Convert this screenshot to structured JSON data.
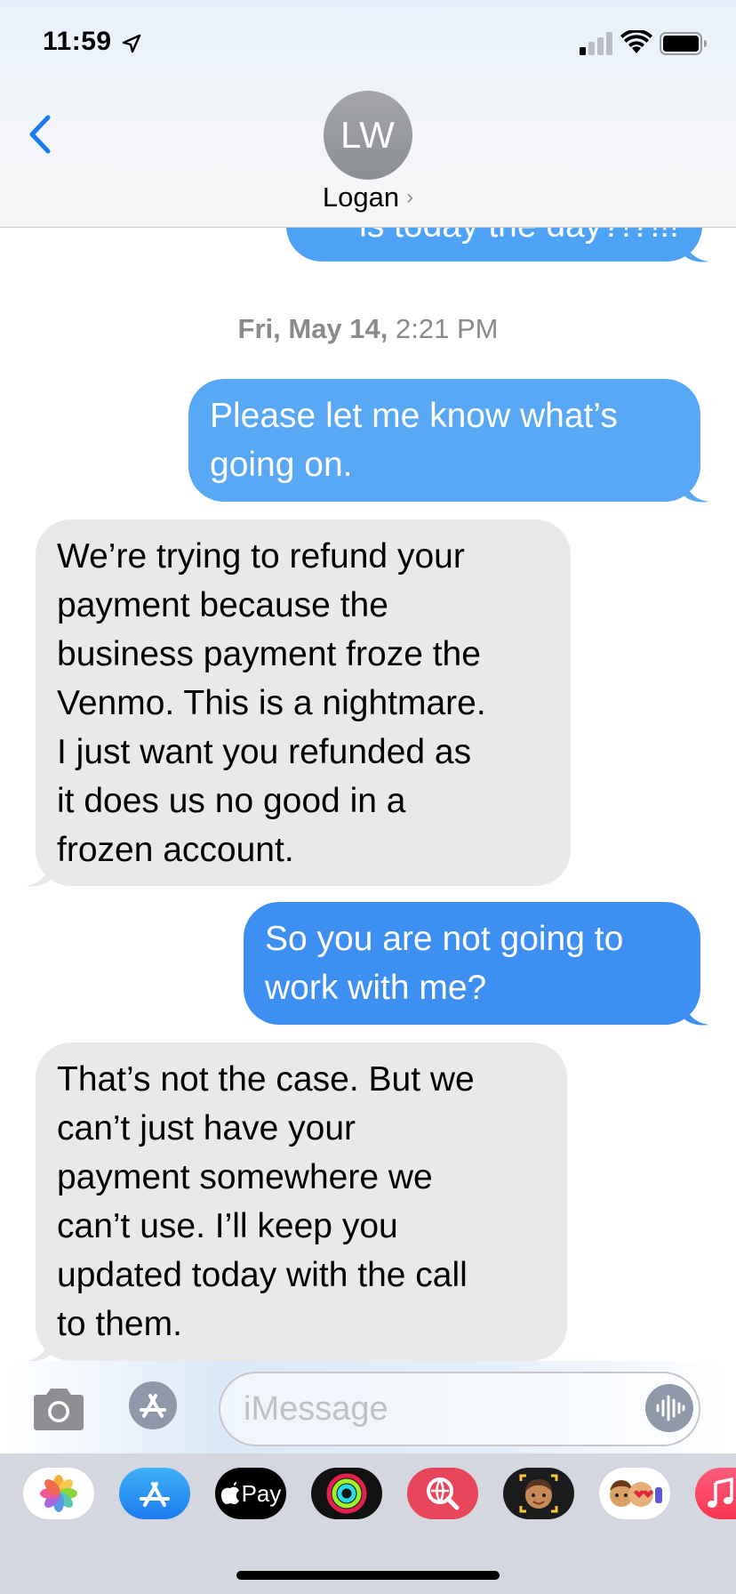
{
  "status_bar": {
    "time": "11:59"
  },
  "header": {
    "avatar_initials": "LW",
    "contact_name": "Logan",
    "chevron": "›"
  },
  "messages": {
    "partial_top": "is today the day?!?!!!",
    "timestamp_date": "Fri, May 14,",
    "timestamp_time": "2:21 PM",
    "items": [
      {
        "direction": "outgoing",
        "lines": [
          "Please let me know what’s",
          "going on."
        ]
      },
      {
        "direction": "incoming",
        "lines": [
          "We’re trying to refund your",
          "payment because the",
          "business payment froze the",
          "Venmo.  This is a nightmare.",
          "I just want you refunded as",
          "it does us no good in a",
          "frozen account."
        ]
      },
      {
        "direction": "outgoing",
        "lines": [
          "So you are not going to",
          "work with me?"
        ]
      },
      {
        "direction": "incoming",
        "lines": [
          "That’s not the case.  But we",
          "can’t just have your",
          "payment somewhere we",
          "can’t use.   I’ll keep you",
          "updated today with the call",
          "to them."
        ]
      }
    ]
  },
  "input": {
    "placeholder": "iMessage"
  },
  "app_drawer": {
    "apple_pay_label": "Pay",
    "apps": [
      "photos-icon",
      "app-store-icon",
      "apple-pay-icon",
      "activity-icon",
      "image-search-icon",
      "memoji-icon",
      "animoji-stickers-icon",
      "music-icon"
    ]
  },
  "colors": {
    "outgoing_bubble": "#3b8cf1",
    "incoming_bubble": "#e9e9eb",
    "accent": "#1a7cf5",
    "avatar": "#9a9ca2"
  }
}
